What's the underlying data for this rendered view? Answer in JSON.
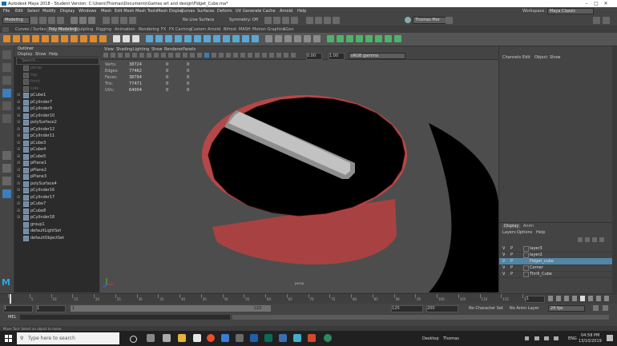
{
  "window": {
    "title": "Autodesk Maya 2018 - Student Version: C:\\Users\\Thomas\\Documents\\Games art and design\\Fidget_Cube.ma*",
    "controls": [
      "–",
      "□",
      "✕"
    ]
  },
  "menu": [
    "File",
    "Edit",
    "Select",
    "Modify",
    "Display",
    "Windows",
    "Mesh",
    "Edit Mesh",
    "Mesh Tools",
    "Mesh Display",
    "Curves",
    "Surfaces",
    "Deform",
    "UV",
    "Generate",
    "Cache",
    "Arnold",
    "Help"
  ],
  "workspace": {
    "label": "Workspace :",
    "value": "Maya Classic"
  },
  "status": {
    "mode": "Modeling",
    "live_surface": "No Live Surface",
    "symmetry": "Symmetry: Off",
    "user": "Thomas Mor"
  },
  "shelf_tabs": [
    "Curves / Surfaces",
    "Poly Modeling",
    "Sculpting",
    "Rigging",
    "Animation",
    "Rendering",
    "FX",
    "FX Caching",
    "Custom",
    "Arnold",
    "Bifrost",
    "MASH",
    "Motion Graphics",
    "XGen"
  ],
  "shelf_active": "Poly Modeling",
  "outliner": {
    "title": "Outliner",
    "menu": [
      "Display",
      "Show",
      "Help"
    ],
    "search_placeholder": "Search...",
    "items": [
      {
        "name": "persp",
        "dim": true
      },
      {
        "name": "top",
        "dim": true
      },
      {
        "name": "front",
        "dim": true
      },
      {
        "name": "side",
        "dim": true
      },
      {
        "name": "pCube1",
        "dim": false
      },
      {
        "name": "pCylinder7",
        "dim": false
      },
      {
        "name": "pCylinder9",
        "dim": false
      },
      {
        "name": "pCylinder10",
        "dim": false
      },
      {
        "name": "polySurface2",
        "dim": false
      },
      {
        "name": "pCylinder12",
        "dim": false
      },
      {
        "name": "pCylinder11",
        "dim": false
      },
      {
        "name": "pCube3",
        "dim": false
      },
      {
        "name": "pCube4",
        "dim": false
      },
      {
        "name": "pCube5",
        "dim": false
      },
      {
        "name": "pPlane1",
        "dim": false
      },
      {
        "name": "pPlane2",
        "dim": false
      },
      {
        "name": "pPlane3",
        "dim": false
      },
      {
        "name": "polySurface4",
        "dim": false
      },
      {
        "name": "pCylinder16",
        "dim": false
      },
      {
        "name": "pCylinder17",
        "dim": false
      },
      {
        "name": "pCube7",
        "dim": false
      },
      {
        "name": "pCube8",
        "dim": false
      },
      {
        "name": "pCylinder18",
        "dim": false
      },
      {
        "name": "group1",
        "dim": false
      },
      {
        "name": "defaultLightSet",
        "dim": false
      },
      {
        "name": "defaultObjectSet",
        "dim": false
      }
    ]
  },
  "viewport": {
    "menu": [
      "View",
      "Shading",
      "Lighting",
      "Show",
      "Renderer",
      "Panels"
    ],
    "field1": "0.00",
    "field2": "1.00",
    "colorspace": "sRGB gamma",
    "camera_label": "persp",
    "hud": [
      {
        "k": "Verts:",
        "a": "38724",
        "b": "0",
        "c": "0"
      },
      {
        "k": "Edges:",
        "a": "77462",
        "b": "0",
        "c": "0"
      },
      {
        "k": "Faces:",
        "a": "38794",
        "b": "0",
        "c": "0"
      },
      {
        "k": "Tris:",
        "a": "77471",
        "b": "0",
        "c": "0"
      },
      {
        "k": "UVs:",
        "a": "64004",
        "b": "0",
        "c": "0"
      }
    ],
    "colors": {
      "bg": "#4d4d4d",
      "rim": "#b84a4a",
      "top": "#000000",
      "slot": "#b8b8b8"
    }
  },
  "channel_box": {
    "menu": [
      "Channels",
      "Edit",
      "Object",
      "Show"
    ]
  },
  "layer_editor": {
    "tabs": [
      "Display",
      "Anim"
    ],
    "menu": [
      "Layers",
      "Options",
      "Help"
    ],
    "layers": [
      {
        "v": "V",
        "p": "P",
        "name": "layer3",
        "selected": false
      },
      {
        "v": "V",
        "p": "P",
        "name": "layer2",
        "selected": false
      },
      {
        "v": "V",
        "p": "P",
        "name": "Fidget_cube",
        "selected": true
      },
      {
        "v": "V",
        "p": "P",
        "name": "Corner",
        "selected": false
      },
      {
        "v": "V",
        "p": "P",
        "name": "Thrill_Cube",
        "selected": false
      }
    ]
  },
  "timeline": {
    "ticks": [
      "1",
      "5",
      "10",
      "15",
      "20",
      "25",
      "30",
      "35",
      "40",
      "45",
      "50",
      "55",
      "60",
      "65",
      "70",
      "75",
      "80",
      "85",
      "90",
      "95",
      "100",
      "105",
      "110",
      "115",
      "120"
    ],
    "current_frame": "1",
    "range_start": "1",
    "range_start2": "1",
    "range_end": "120",
    "range_end2": "120",
    "anim_end": "200",
    "character_set": "No Character Set",
    "anim_layer": "No Anim Layer",
    "fps": "24 fps"
  },
  "command_line": {
    "label": "MEL"
  },
  "help_line": "Move Tool: Select an object to move.",
  "taskbar": {
    "search_placeholder": "Type here to search",
    "desktop_label": "Desktop",
    "user_label": "Thomas",
    "lang": "ENG",
    "time": "04:58 PM",
    "date": "13/10/2019"
  }
}
